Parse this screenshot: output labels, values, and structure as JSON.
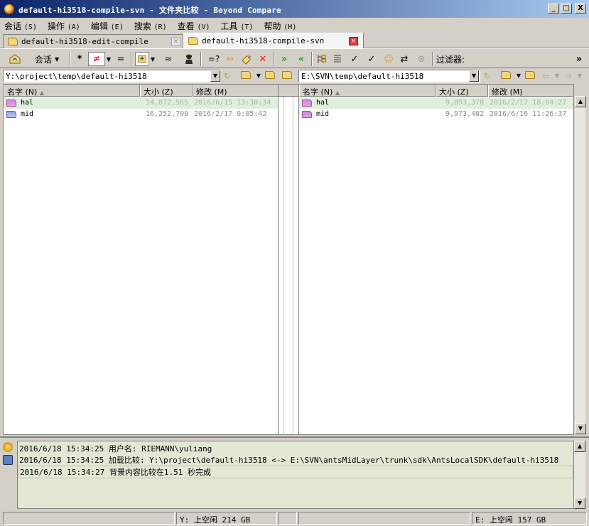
{
  "window": {
    "title": "default-hi3518-compile-svn - 文件夹比较 - Beyond Compare",
    "min": "_",
    "max": "□",
    "close": "X"
  },
  "menu": [
    {
      "label": "会话",
      "acc": "(S)"
    },
    {
      "label": "操作",
      "acc": "(A)"
    },
    {
      "label": "编辑",
      "acc": "(E)"
    },
    {
      "label": "搜索",
      "acc": "(R)"
    },
    {
      "label": "查看",
      "acc": "(V)"
    },
    {
      "label": "工具",
      "acc": "(T)"
    },
    {
      "label": "帮助",
      "acc": "(H)"
    }
  ],
  "tabs": [
    {
      "label": "default-hi3518-edit-compile",
      "active": false
    },
    {
      "label": "default-hi3518-compile-svn",
      "active": true
    }
  ],
  "toolbar": {
    "session_label": "会话",
    "filter_label": "过滤器:",
    "overflow": "»"
  },
  "left": {
    "path": "Y:\\project\\temp\\default-hi3518",
    "columns": {
      "name": "名字 (N)",
      "size": "大小 (Z)",
      "modified": "修改 (M)"
    },
    "rows": [
      {
        "name": "hal",
        "size": "14,872,565",
        "modified": "2016/6/15 13:30:34",
        "icon": "pink-folder-icon"
      },
      {
        "name": "mid",
        "size": "16,252,709",
        "modified": "2016/2/17 9:05:42",
        "icon": "blue-folder-icon"
      }
    ]
  },
  "right": {
    "path": "E:\\SVN\\temp\\default-hi3518",
    "columns": {
      "name": "名字 (N)",
      "size": "大小 (Z)",
      "modified": "修改 (M)"
    },
    "rows": [
      {
        "name": "hal",
        "size": "9,893,378",
        "modified": "2016/2/17 18:04:27",
        "icon": "pink-folder-icon"
      },
      {
        "name": "mid",
        "size": "9,973,482",
        "modified": "2016/6/16 11:26:37",
        "icon": "pink-folder-icon"
      }
    ]
  },
  "log": [
    "2016/6/18 15:34:25  用户名: RIEMANN\\yuliang",
    "2016/6/18 15:34:25  加载比较: Y:\\project\\default-hi3518 <-> E:\\SVN\\antsMidLayer\\trunk\\sdk\\AntsLocalSDK\\default-hi3518",
    "2016/6/18 15:34:27  背景内容比较在1.51 秒完成"
  ],
  "status": {
    "left": "Y: 上空闲 214 GB",
    "right": "E: 上空闲 157 GB"
  },
  "colors": {
    "title_start": "#0a246a",
    "title_end": "#a6caf0",
    "row_highlight": "#dfeedd",
    "log_bg": "#e2e8d4"
  }
}
